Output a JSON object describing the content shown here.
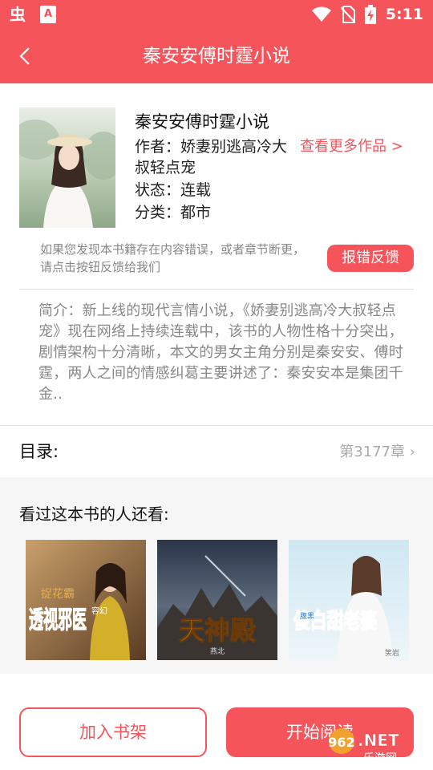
{
  "status_bar": {
    "app_icon_1": "虫",
    "app_icon_2": "A",
    "time": "5:11",
    "icons": [
      "wifi-icon",
      "no-sim-icon",
      "battery-charging-icon"
    ]
  },
  "header": {
    "title": "秦安安傅时霆小说"
  },
  "book": {
    "title": "秦安安傅时霆小说",
    "author_line": "作者：娇妻别逃高冷大叔轻点宠",
    "more_works": "查看更多作品 >",
    "status_line": "状态：连载",
    "category_line": "分类：都市"
  },
  "report": {
    "note": "如果您发现本书籍存在内容错误，或者章节断更，请点击按钮反馈给我们",
    "button": "报错反馈"
  },
  "intro": "简介：新上线的现代言情小说，《娇妻别逃高冷大叔轻点宠》现在网络上持续连载中，该书的人物性格十分突出，剧情架构十分清晰，本文的男女主角分别是秦安安、傅时霆，两人之间的情感纠葛主要讲述了：秦安安本是集团千金..",
  "toc": {
    "label": "目录:",
    "chapter": "第3177章",
    "chevron": "›"
  },
  "recommend": {
    "heading": "看过这本书的人还看:",
    "books": [
      {
        "cover_title": "透视邪医",
        "cover_sub": "捉花霸",
        "cover_author": "容幻"
      },
      {
        "cover_title": "天神殿",
        "cover_author": "燕北"
      },
      {
        "cover_title": "傻白甜老婆",
        "cover_sub": "腹黑",
        "cover_author": "笑岩"
      }
    ]
  },
  "actions": {
    "add_shelf": "加入书架",
    "start_read": "开始阅读"
  },
  "watermark": {
    "brand": "962",
    "domain": ".NET",
    "subtitle": "乐游网"
  },
  "colors": {
    "accent": "#f4545a",
    "muted_text": "#888888",
    "background_section": "#f6f6f6"
  }
}
